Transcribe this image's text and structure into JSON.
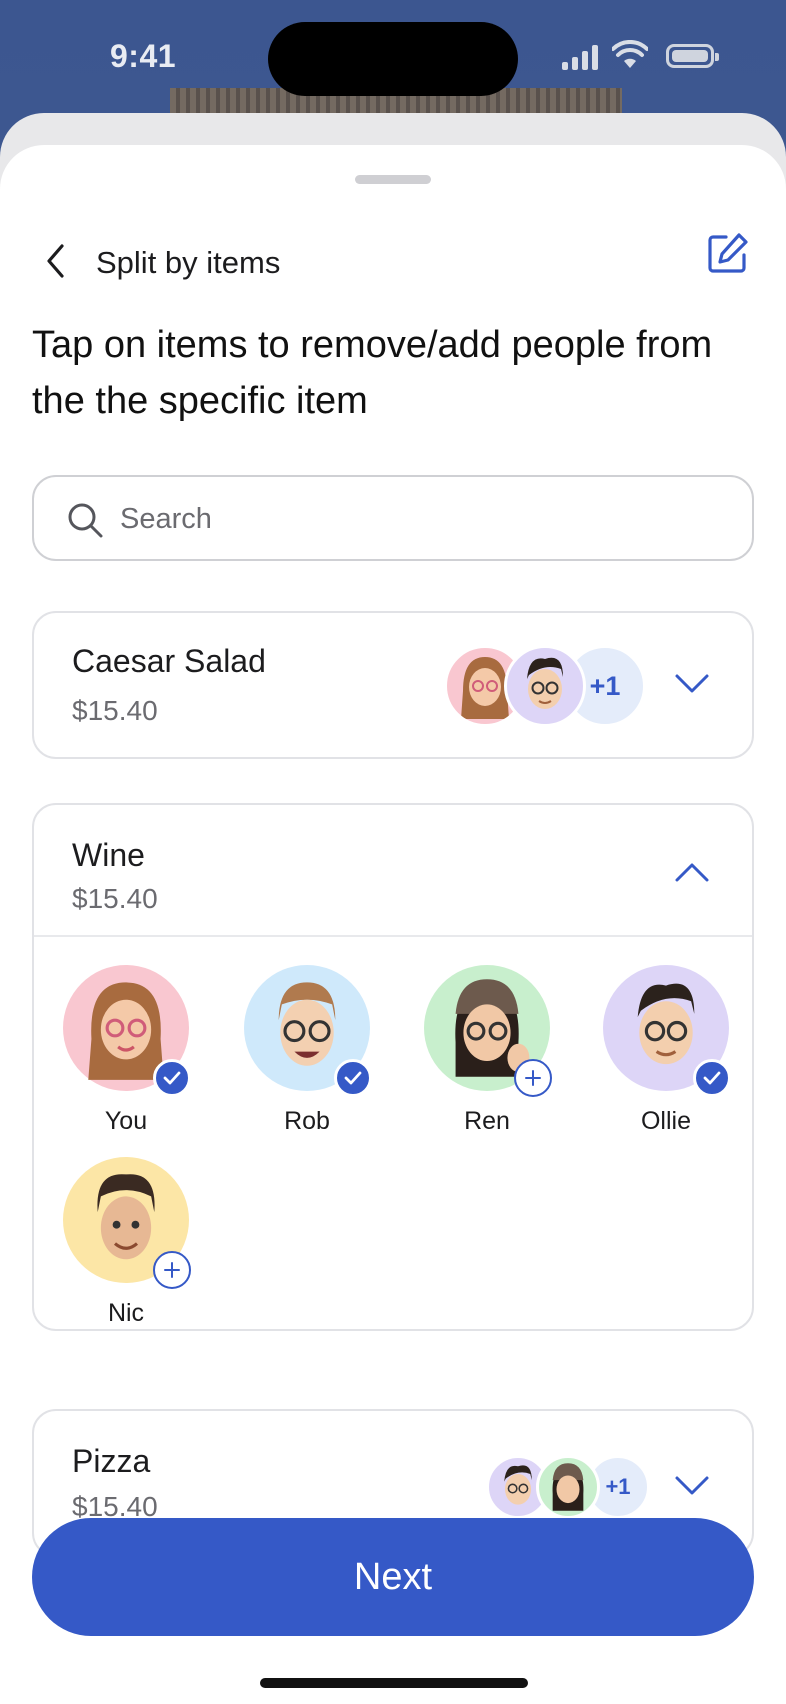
{
  "status_bar": {
    "time": "9:41"
  },
  "nav": {
    "title": "Split by items",
    "back_icon": "chevron-left-icon",
    "edit_icon": "edit-icon"
  },
  "heading": "Tap on items to remove/add people from the the specific item",
  "search": {
    "placeholder": "Search",
    "value": ""
  },
  "items": [
    {
      "name": "Caesar Salad",
      "price": "$15.40",
      "extra_count": "+1",
      "expanded": false
    },
    {
      "name": "Wine",
      "price": "$15.40",
      "expanded": true,
      "people": [
        {
          "name": "You",
          "selected": true,
          "bg": "#f9c7d0"
        },
        {
          "name": "Rob",
          "selected": true,
          "bg": "#cfe9fb"
        },
        {
          "name": "Ren",
          "selected": false,
          "bg": "#c8efcd"
        },
        {
          "name": "Ollie",
          "selected": true,
          "bg": "#ddd5f7"
        },
        {
          "name": "Nic",
          "selected": false,
          "bg": "#fce6a6"
        }
      ]
    },
    {
      "name": "Pizza",
      "price": "$15.40",
      "extra_count": "+1",
      "expanded": false
    }
  ],
  "next_label": "Next",
  "colors": {
    "accent": "#3559c7",
    "accent_light": "#e4ecfa"
  }
}
